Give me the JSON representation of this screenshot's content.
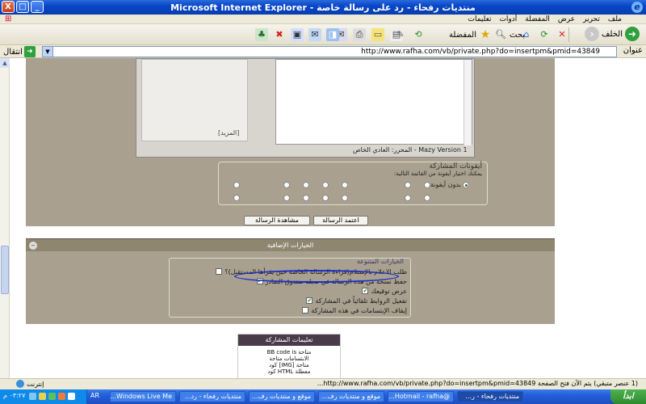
{
  "window": {
    "title": "منتديات رفحاء - رد على رسالة خاصة - Microsoft Internet Explorer",
    "min": "_",
    "max": "□",
    "close": "X",
    "ie_logo": "e"
  },
  "menubar": {
    "items": [
      "ملف",
      "تحرير",
      "عرض",
      "المفضلة",
      "أدوات",
      "تعليمات"
    ]
  },
  "toolbar": {
    "back_label": "الخلف",
    "search_label": "بحث",
    "favorites_label": "المفضلة"
  },
  "address": {
    "label": "عنوان",
    "url": "http://www.rafha.com/vb/private.php?do=insertpm&pmid=43849",
    "go_label": "انتقال"
  },
  "editor": {
    "toggle_tag": "[المزيد]",
    "footer": "المحرر: العادي الخاص - Mazy Version 1"
  },
  "post_icons": {
    "title": "أيقونات المشاركة",
    "subtitle": "يمكنك اختيار أيقونة من القائمة التالية:",
    "no_icon_label": "بدون أيقونة"
  },
  "buttons": {
    "submit": "اعتمد الرسالة",
    "preview": "مشاهدة الرسالة"
  },
  "extra": {
    "header": "الخيارات الإضافية",
    "collapse": "−",
    "options_title": "الخيارات المتنوعة",
    "options": [
      {
        "label": "طلب الاعلام بالإستلام(قراءة الرسالة الخاصة حين يقرأها المستقبل)؟",
        "checked": false
      },
      {
        "label": "حفظ نسخة من هذه الرسالة في مجلد صندوق الصادر",
        "checked": true
      },
      {
        "label": "عرض توقيعك",
        "checked": true
      },
      {
        "label": "تفعيل الروابط تلقائياً في المشاركة",
        "checked": true
      },
      {
        "label": "إيقاف الإبتسامات في هذه المشاركة",
        "checked": false
      }
    ]
  },
  "rules": {
    "title": "تعليمات المشاركة",
    "lines": [
      "BB code is متاحة",
      "الابتسامات متاحة",
      "كود [IMG] متاحة",
      "كود HTML معطلة"
    ]
  },
  "status": {
    "text": "(1 عنصر متبقي) يتم الآن فتح الصفحة http://www.rafha.com/vb/private.php?do=insertpm&pmid=43849...",
    "zone": "إنترنت"
  },
  "taskbar": {
    "start": "ابدأ",
    "lang": "AR",
    "clock": "٠٣:٢٧ م",
    "tasks": [
      {
        "label": "منتديات رفحاء - ر...",
        "active": true
      },
      {
        "label": "@Hotmail - rafha...",
        "active": false
      },
      {
        "label": "موقع و منتديات رف...",
        "active": false
      },
      {
        "label": "موقع و منتديات رف...",
        "active": false
      },
      {
        "label": "منتديات رفحاء - رد...",
        "active": false
      },
      {
        "label": "Windows Live Me...",
        "active": false
      }
    ]
  },
  "colors": {
    "titlebar": "#0a46c8",
    "panel": "#a9a08f",
    "highlight_ellipse": "#1a2fc9"
  }
}
